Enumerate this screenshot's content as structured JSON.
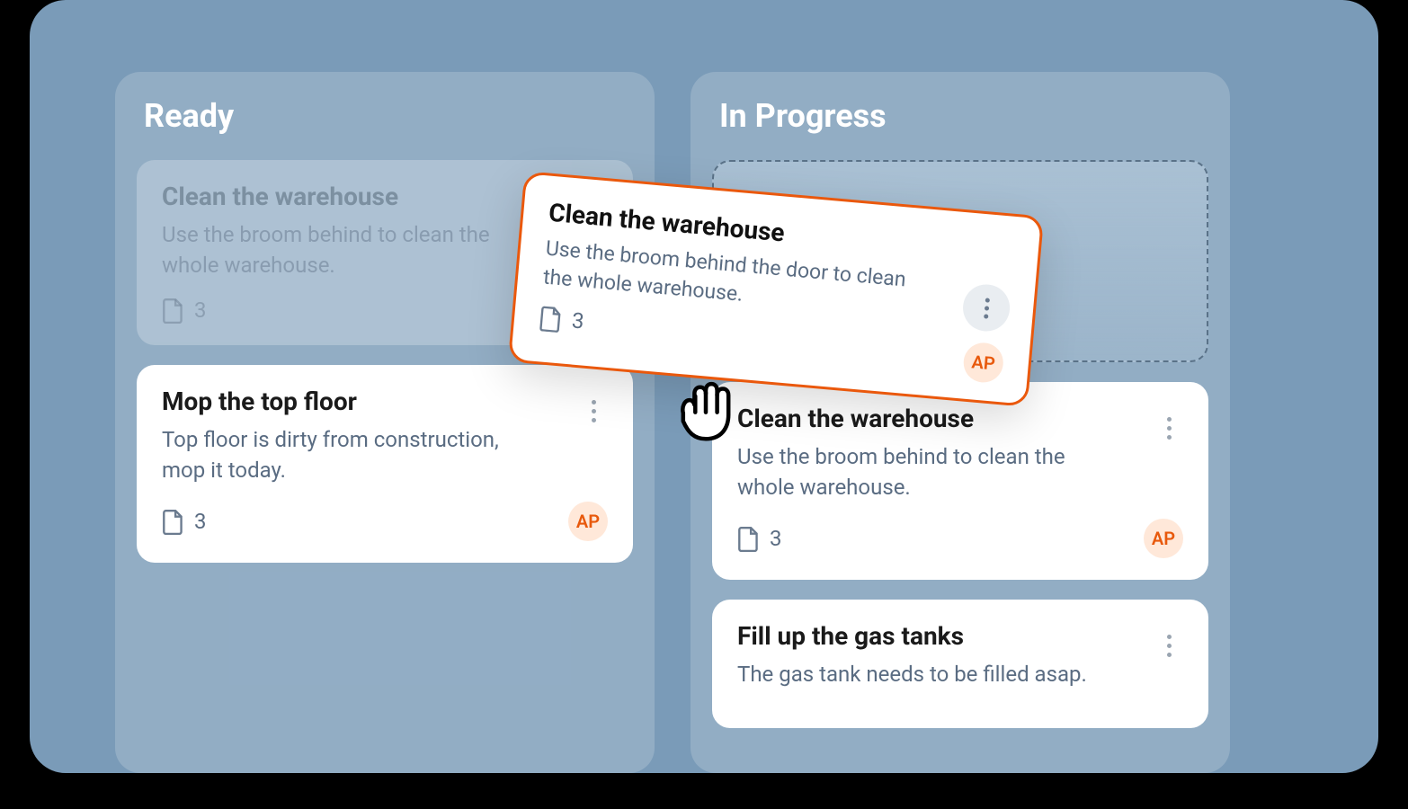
{
  "columns": {
    "ready": {
      "title": "Ready",
      "cards": [
        {
          "title": "Clean the warehouse",
          "description": "Use the broom behind to clean the whole warehouse.",
          "file_count": "3"
        },
        {
          "title": "Mop the top floor",
          "description": "Top floor is dirty from construction, mop it today.",
          "file_count": "3",
          "assignee": "AP"
        }
      ]
    },
    "in_progress": {
      "title": "In Progress",
      "cards": [
        {
          "title": "Clean the warehouse",
          "description": "Use the broom behind to clean the whole warehouse.",
          "file_count": "3",
          "assignee": "AP"
        },
        {
          "title": "Fill up the gas tanks",
          "description": "The gas tank needs to be filled asap."
        }
      ]
    }
  },
  "dragging_card": {
    "title": "Clean the warehouse",
    "description": "Use the broom behind the door to clean the whole warehouse.",
    "file_count": "3",
    "assignee": "AP"
  }
}
